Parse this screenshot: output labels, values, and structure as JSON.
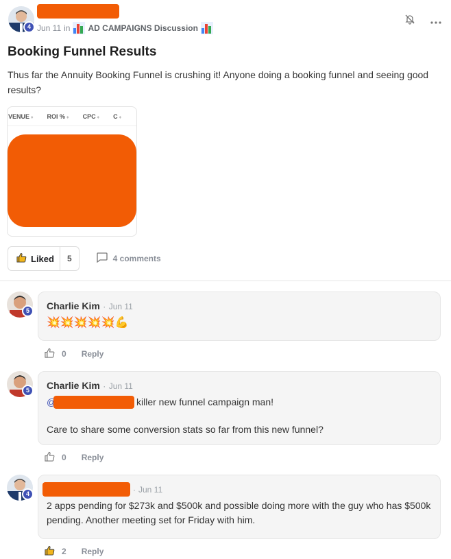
{
  "post": {
    "date": "Jun 11",
    "in_label": "in",
    "category": "AD CAMPAIGNS Discussion",
    "author_level": "4",
    "title": "Booking Funnel Results",
    "body": "Thus far the Annuity Booking Funnel is crushing it! Anyone doing a booking funnel and seeing good results?",
    "attachment_columns": [
      "VENUE",
      "ROI %",
      "CPC",
      "C"
    ],
    "liked_label": "Liked",
    "like_count": "5",
    "comments_label": "4 comments"
  },
  "comments": [
    {
      "name": "Charlie Kim",
      "sep": "·",
      "date": "Jun 11",
      "level": "5",
      "emojis": "💥💥💥💥💥💪",
      "like_count": "0",
      "reply": "Reply"
    },
    {
      "name": "Charlie Kim",
      "sep": "·",
      "date": "Jun 11",
      "level": "5",
      "mention_prefix": "@",
      "line1": "killer new funnel campaign man!",
      "line2": "Care to share some conversion stats so far from this new funnel?",
      "like_count": "0",
      "reply": "Reply"
    },
    {
      "sep": "·",
      "date": "Jun 11",
      "level": "4",
      "text": "2 apps pending for $273k and $500k and possible doing more with the guy who has $500k pending. Another meeting set for Friday with him.",
      "like_count": "2",
      "reply": "Reply"
    }
  ],
  "colors": {
    "redaction": "#f25c05",
    "badge": "#3f51b5"
  },
  "icons": [
    "bell-off-icon",
    "more-icon",
    "thumbs-up-icon",
    "comment-icon",
    "bar-chart-icon"
  ]
}
